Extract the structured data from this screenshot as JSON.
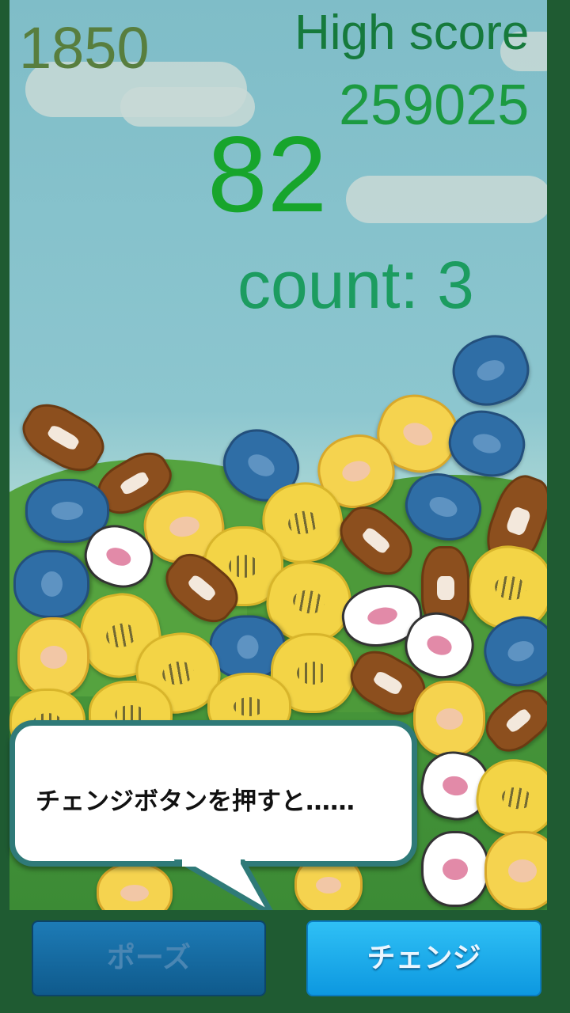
{
  "hud": {
    "score": "1850",
    "high_score_label": "High score",
    "high_score_value": "259025",
    "timer": "82",
    "count_text": "count: 3"
  },
  "tutorial": {
    "bubble_text": "チェンジボタンを押すと……"
  },
  "buttons": {
    "pause_label": "ポーズ",
    "change_label": "チェンジ"
  },
  "colors": {
    "background": "#1f5b32",
    "tiger": "#f3d446",
    "dog": "#f5d34f",
    "horse": "#8c4f1e",
    "elephant": "#2f6ea6",
    "cow": "#ffffff",
    "change_button": "#1aa8ea",
    "pause_button": "#155f8f"
  }
}
